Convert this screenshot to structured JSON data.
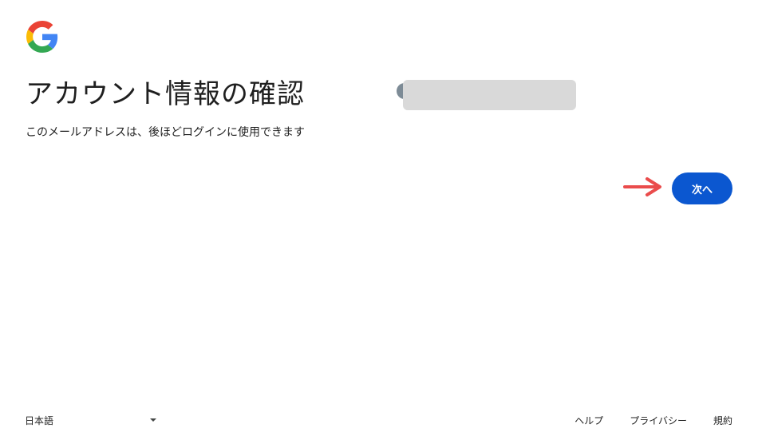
{
  "header": {
    "logo_icon": "google-g-logo"
  },
  "main": {
    "title": "アカウント情報の確認",
    "subtitle": "このメールアドレスは、後ほどログインに使用できます",
    "next_label": "次へ"
  },
  "footer": {
    "language": "日本語",
    "links": [
      "ヘルプ",
      "プライバシー",
      "規約"
    ]
  },
  "colors": {
    "primary_button": "#0b57d0",
    "arrow": "#ea4c4c",
    "redaction": "#d9d9d9"
  }
}
